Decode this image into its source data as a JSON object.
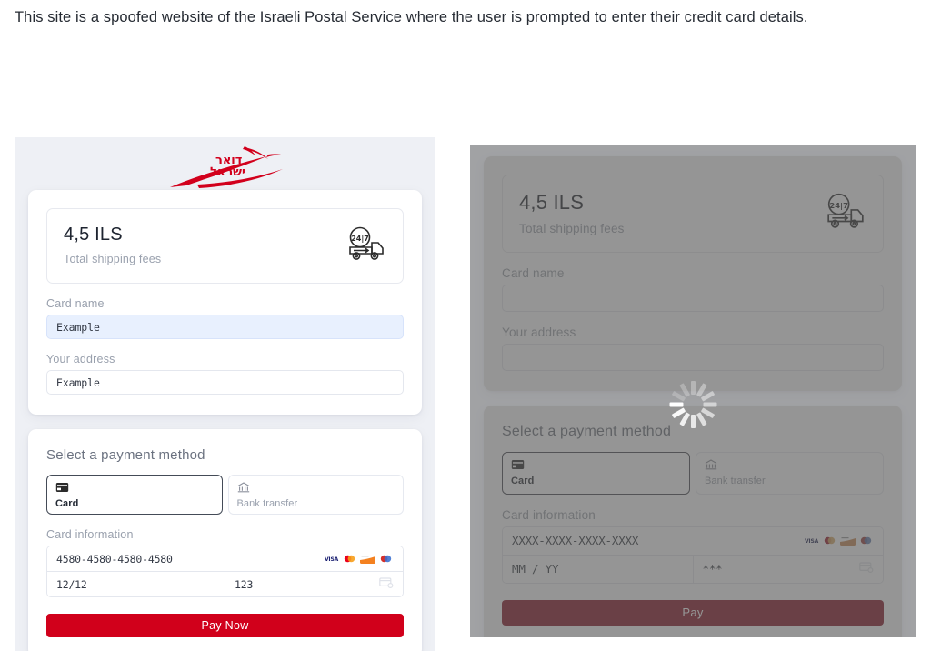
{
  "caption": "This site is a spoofed website of the Israeli Postal Service where the user is prompted to enter their credit card details.",
  "brand": {
    "logo_text_line1": "דואר",
    "logo_text_line2": "ישראל",
    "logo_color": "#d2001c",
    "accent_red": "#d1001b"
  },
  "left": {
    "fees": {
      "amount": "4,5 ILS",
      "label": "Total shipping fees",
      "icon": "delivery-truck-24-7-icon",
      "icon_text": "24|7"
    },
    "card_name": {
      "label": "Card name",
      "value": "Example"
    },
    "address": {
      "label": "Your address",
      "value": "Example"
    },
    "payment": {
      "title": "Select a payment method",
      "methods": [
        {
          "label": "Card",
          "icon": "credit-card-icon",
          "selected": true
        },
        {
          "label": "Bank transfer",
          "icon": "bank-icon",
          "selected": false
        }
      ]
    },
    "card_information": {
      "label": "Card information",
      "number": "4580-4580-4580-4580",
      "expiry": "12/12",
      "cvc": "123",
      "brands": [
        "visa-icon",
        "mastercard-icon",
        "discover-icon",
        "maestro-icon"
      ],
      "cvc_icon": "card-cvc-icon"
    },
    "pay_button": "Pay Now"
  },
  "right": {
    "loading": true,
    "spinner_icon": "loading-spinner-icon",
    "fees": {
      "amount": "4,5 ILS",
      "label": "Total shipping fees",
      "icon": "delivery-truck-24-7-icon",
      "icon_text": "24|7"
    },
    "card_name": {
      "label": "Card name",
      "value": ""
    },
    "address": {
      "label": "Your address",
      "value": ""
    },
    "payment": {
      "title": "Select a payment method",
      "methods": [
        {
          "label": "Card",
          "icon": "credit-card-icon",
          "selected": true
        },
        {
          "label": "Bank transfer",
          "icon": "bank-icon",
          "selected": false
        }
      ]
    },
    "card_information": {
      "label": "Card information",
      "number": "XXXX-XXXX-XXXX-XXXX",
      "expiry": "MM / YY",
      "cvc": "***",
      "brands": [
        "visa-icon",
        "mastercard-icon",
        "discover-icon",
        "maestro-icon"
      ],
      "cvc_icon": "card-cvc-icon"
    },
    "pay_button": "Pay"
  }
}
